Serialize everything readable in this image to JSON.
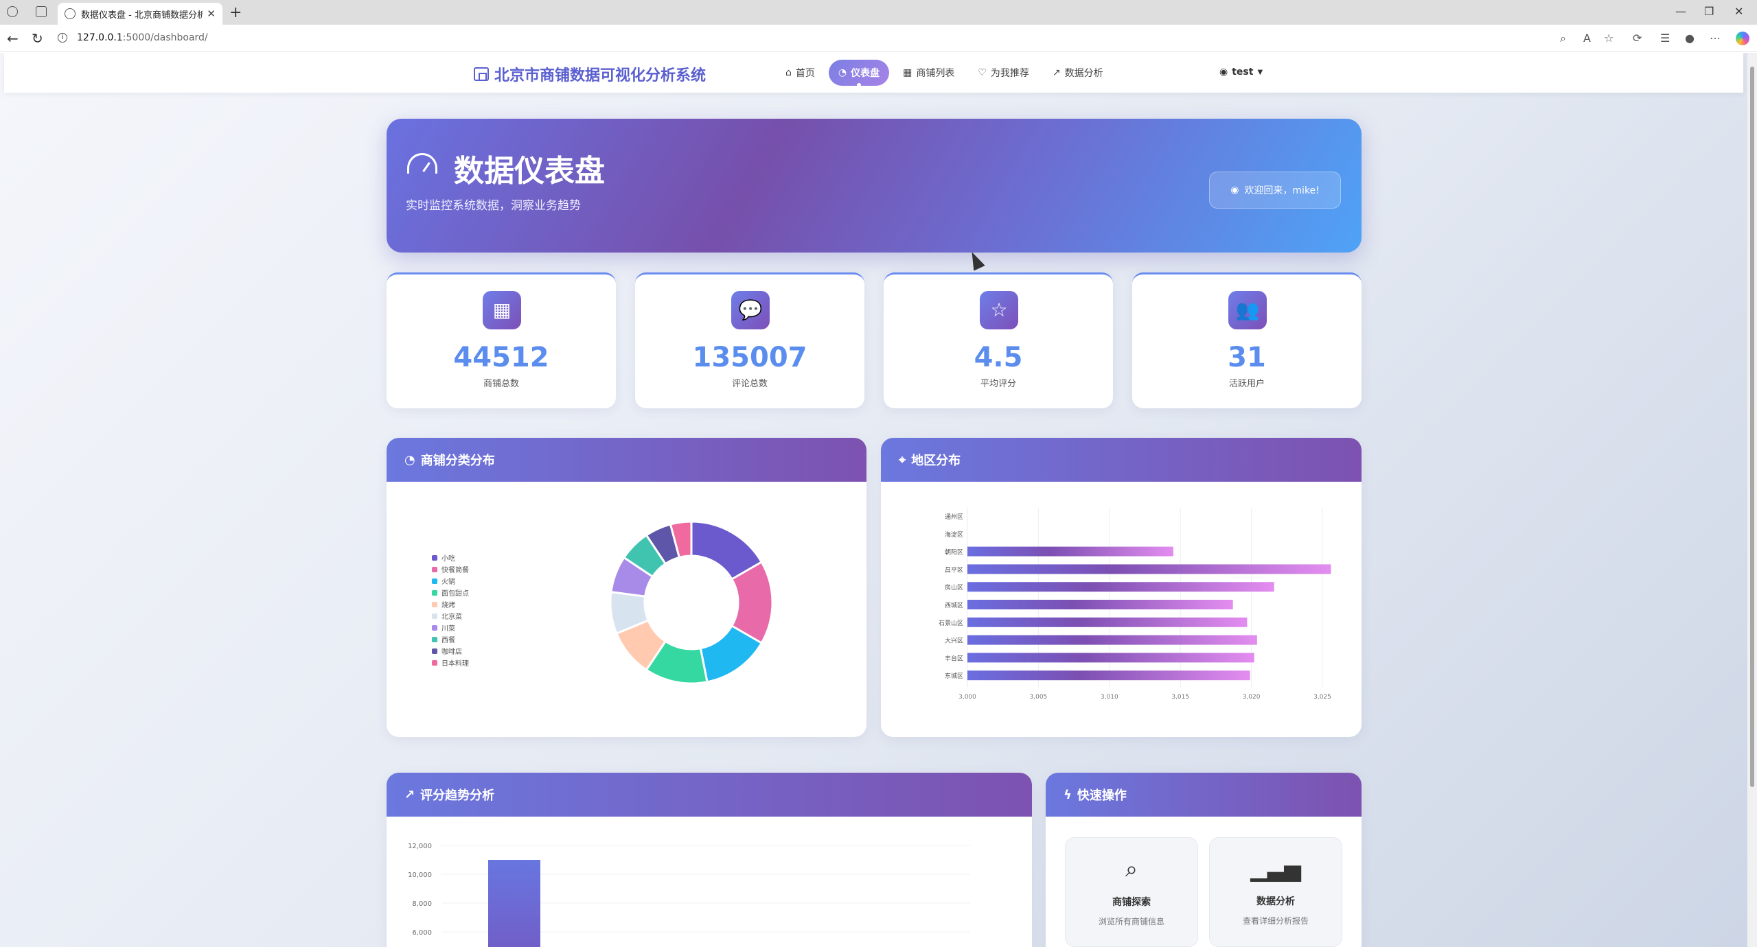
{
  "browser": {
    "tab_title": "数据仪表盘 - 北京商铺数据分析系",
    "url_host": "127.0.0.1",
    "url_path": ":5000/dashboard/"
  },
  "navbar": {
    "brand": "北京市商铺数据可视化分析系统",
    "links": [
      {
        "label": "首页",
        "icon": "home-icon"
      },
      {
        "label": "仪表盘",
        "icon": "gauge-icon",
        "active": true
      },
      {
        "label": "商铺列表",
        "icon": "store-icon"
      },
      {
        "label": "为我推荐",
        "icon": "bulb-icon"
      },
      {
        "label": "数据分析",
        "icon": "chart-icon"
      }
    ],
    "user": "test"
  },
  "hero": {
    "title": "数据仪表盘",
    "subtitle": "实时监控系统数据，洞察业务趋势",
    "welcome": "欢迎回来，mike!"
  },
  "stats": [
    {
      "value": "44512",
      "label": "商铺总数",
      "icon": "store-icon"
    },
    {
      "value": "135007",
      "label": "评论总数",
      "icon": "comment-icon"
    },
    {
      "value": "4.5",
      "label": "平均评分",
      "icon": "star-icon"
    },
    {
      "value": "31",
      "label": "活跃用户",
      "icon": "users-icon"
    }
  ],
  "cards": {
    "category": "商铺分类分布",
    "region": "地区分布",
    "trend": "评分趋势分析",
    "quick": "快速操作"
  },
  "quick_actions": [
    {
      "title": "商铺探索",
      "desc": "浏览所有商铺信息",
      "icon": "search-icon"
    },
    {
      "title": "数据分析",
      "desc": "查看详细分析报告",
      "icon": "bar-chart-icon"
    }
  ],
  "chart_data": [
    {
      "type": "pie",
      "title": "商铺分类分布",
      "legend_position": "left",
      "categories": [
        "小吃",
        "快餐简餐",
        "火锅",
        "面包甜点",
        "烧烤",
        "北京菜",
        "川菜",
        "西餐",
        "咖啡店",
        "日本料理"
      ],
      "values": [
        16,
        16,
        13,
        12,
        9,
        8,
        7,
        6,
        5,
        4
      ],
      "colors": [
        "#6a5acd",
        "#e86aa8",
        "#1fb8f0",
        "#34d8a0",
        "#ffcab0",
        "#d8e3f0",
        "#a88be8",
        "#40c4b0",
        "#5e56a8",
        "#f06aa0"
      ]
    },
    {
      "type": "bar",
      "orientation": "horizontal",
      "title": "地区分布",
      "categories": [
        "通州区",
        "海淀区",
        "朝阳区",
        "昌平区",
        "房山区",
        "西城区",
        "石景山区",
        "大兴区",
        "丰台区",
        "东城区"
      ],
      "values": [
        null,
        null,
        3014.5,
        3025.6,
        3021.6,
        3018.7,
        3019.7,
        3020.4,
        3020.2,
        3019.9
      ],
      "xlim": [
        3000,
        3025
      ],
      "x_ticks": [
        "3,000",
        "3,005",
        "3,010",
        "3,015",
        "3,020",
        "3,025"
      ],
      "grid": true
    },
    {
      "type": "bar",
      "title": "评分趋势分析",
      "y_ticks": [
        "12,000",
        "10,000",
        "8,000",
        "6,000"
      ],
      "values": [
        11000
      ],
      "grid": true
    }
  ]
}
